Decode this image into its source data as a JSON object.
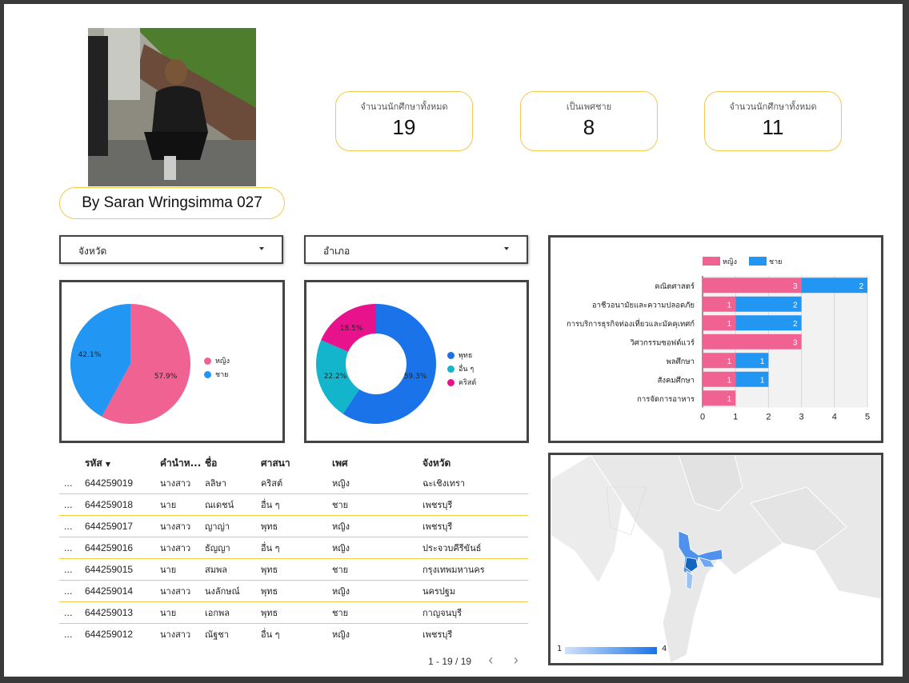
{
  "profile": {
    "name_label": "By Saran Wringsimma 027"
  },
  "kpis": [
    {
      "label": "จำนวนนักศึกษาทั้งหมด",
      "value": "19"
    },
    {
      "label": "เป็นเพศชาย",
      "value": "8"
    },
    {
      "label": "จำนวนนักศึกษาทั้งหมด",
      "value": "11"
    }
  ],
  "filters": {
    "province": "จังหวัด",
    "district": "อำเภอ"
  },
  "colors": {
    "female": "#f06292",
    "male": "#2196f3",
    "buddhist": "#1a73e8",
    "other": "#12b5cb",
    "christian": "#e8128c",
    "accent": "#f2c94c"
  },
  "gender_pie": {
    "legend": [
      "หญิง",
      "ชาย"
    ],
    "labels": [
      "57.9%",
      "42.1%"
    ]
  },
  "religion_donut": {
    "legend": [
      "พุทธ",
      "อื่น ๆ",
      "คริสต์"
    ],
    "labels": [
      "59.3%",
      "22.2%",
      "18.5%"
    ]
  },
  "chart_data": [
    {
      "type": "pie",
      "categories": [
        "หญิง",
        "ชาย"
      ],
      "values": [
        57.9,
        42.1
      ]
    },
    {
      "type": "pie",
      "categories": [
        "พุทธ",
        "อื่น ๆ",
        "คริสต์"
      ],
      "values": [
        59.3,
        22.2,
        18.5
      ]
    },
    {
      "type": "bar",
      "orientation": "horizontal",
      "stacked": true,
      "categories": [
        "คณิตศาสตร์",
        "อาชีวอนามัยและความปลอดภัย",
        "การบริการธุรกิจท่องเที่ยวและมัคคุเทศก์",
        "วิศวกรรมซอฟต์แวร์",
        "พลศึกษา",
        "สังคมศึกษา",
        "การจัดการอาหาร"
      ],
      "series": [
        {
          "name": "หญิง",
          "values": [
            3,
            1,
            1,
            3,
            1,
            1,
            1
          ]
        },
        {
          "name": "ชาย",
          "values": [
            2,
            2,
            2,
            0,
            1,
            1,
            0
          ]
        }
      ],
      "xlim": [
        0,
        5
      ],
      "xticks": [
        "0",
        "1",
        "2",
        "3",
        "4",
        "5"
      ],
      "legend": "top",
      "grid": true
    }
  ],
  "table": {
    "headers": [
      "รหัส",
      "คำนำห...",
      "ชื่อ",
      "ศาสนา",
      "เพศ",
      "จังหวัด"
    ],
    "rows": [
      [
        "644259019",
        "นางสาว",
        "ลลิษา",
        "คริสต์",
        "หญิง",
        "ฉะเชิงเทรา"
      ],
      [
        "644259018",
        "นาย",
        "ณเดชน์",
        "อื่น ๆ",
        "ชาย",
        "เพชรบุรี"
      ],
      [
        "644259017",
        "นางสาว",
        "ญาญ่า",
        "พุทธ",
        "หญิง",
        "เพชรบุรี"
      ],
      [
        "644259016",
        "นางสาว",
        "ธัญญา",
        "อื่น ๆ",
        "หญิง",
        "ประจวบคีรีขันธ์"
      ],
      [
        "644259015",
        "นาย",
        "สมพล",
        "พุทธ",
        "ชาย",
        "กรุงเทพมหานคร"
      ],
      [
        "644259014",
        "นางสาว",
        "นงลักษณ์",
        "พุทธ",
        "หญิง",
        "นครปฐม"
      ],
      [
        "644259013",
        "นาย",
        "เอกพล",
        "พุทธ",
        "ชาย",
        "กาญจนบุรี"
      ],
      [
        "644259012",
        "นางสาว",
        "ณัฐชา",
        "อื่น ๆ",
        "หญิง",
        "เพชรบุรี"
      ]
    ],
    "row_menu": "...",
    "pagination": "1 - 19 / 19"
  },
  "map": {
    "scale_min": "1",
    "scale_max": "4"
  }
}
